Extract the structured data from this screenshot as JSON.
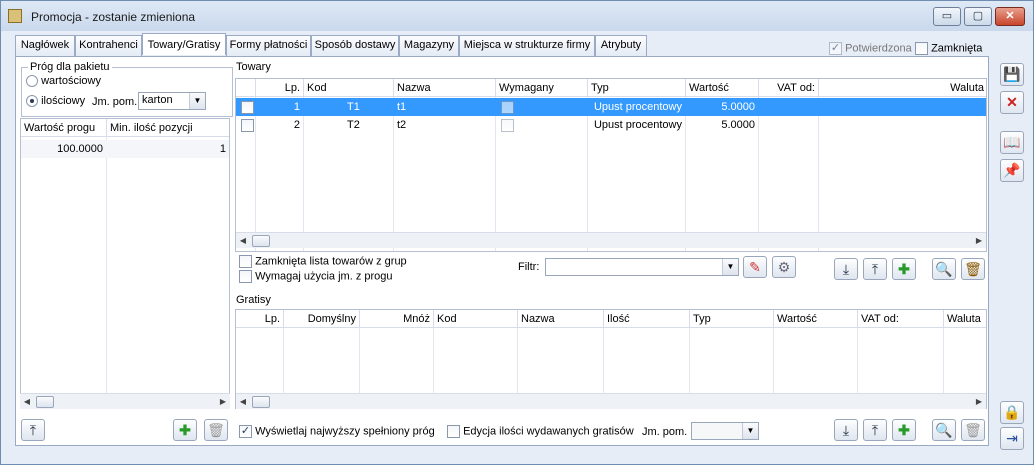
{
  "window": {
    "title": "Promocja - zostanie zmieniona",
    "minimize": "▭",
    "maximize": "▢",
    "close": "✕"
  },
  "tabs": [
    "Nagłówek",
    "Kontrahenci",
    "Towary/Gratisy",
    "Formy płatności",
    "Sposób dostawy",
    "Magazyny",
    "Miejsca w strukturze firmy",
    "Atrybuty"
  ],
  "header_flags": {
    "potwierdzona": "Potwierdzona",
    "zamknieta": "Zamknięta"
  },
  "left": {
    "group_title": "Próg dla pakietu",
    "radio_wartosciowy": "wartościowy",
    "radio_ilosciowy": "ilościowy",
    "jm_label": "Jm. pom.",
    "jm_value": "karton",
    "columns": [
      "Wartość progu",
      "Min. ilość pozycji"
    ],
    "rows": [
      {
        "wartosc": "100.0000",
        "min_ilosc": "1"
      }
    ]
  },
  "towary": {
    "title": "Towary",
    "columns": [
      "Lp.",
      "Kod",
      "Nazwa",
      "Wymagany",
      "Typ",
      "Wartość",
      "VAT od:",
      "Waluta"
    ],
    "rows": [
      {
        "lp": "1",
        "kod": "T1",
        "nazwa": "t1",
        "typ": "Upust procentowy",
        "wartosc": "5.0000"
      },
      {
        "lp": "2",
        "kod": "T2",
        "nazwa": "t2",
        "typ": "Upust procentowy",
        "wartosc": "5.0000"
      }
    ],
    "zamknieta_lista": "Zamknięta lista towarów z grup",
    "wymagaj_jm": "Wymagaj użycia jm. z progu",
    "filtr_label": "Filtr:"
  },
  "gratisy": {
    "title": "Gratisy",
    "columns": [
      "Lp.",
      "Domyślny",
      "Mnóż",
      "Kod",
      "Nazwa",
      "Ilość",
      "Typ",
      "Wartość",
      "VAT od:",
      "Waluta"
    ]
  },
  "bottom": {
    "wyswietlaj": "Wyświetlaj najwyższy spełniony próg",
    "edycja": "Edycja ilości wydawanych gratisów",
    "jm_label": "Jm. pom."
  },
  "icons": [
    "save-icon",
    "delete-icon",
    "book-icon",
    "pin-icon",
    "lock-icon",
    "export-icon"
  ]
}
